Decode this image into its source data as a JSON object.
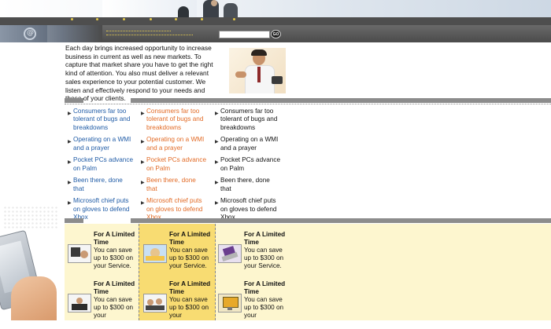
{
  "search": {
    "placeholder": "",
    "go_label": "GO"
  },
  "intro_text": "Each day brings increased opportunity to increase business in current as well as new markets. To capture that market share you have to get the right kind of attention. You also must deliver a relevant sales experience to your potential customer. We listen and effectively respond to your needs and those of your clients.",
  "news_columns": [
    {
      "color": "#1f5ba6",
      "items": [
        "Consumers far too tolerant of bugs and breakdowns",
        "Operating on a WMI and a prayer",
        "Pocket PCs advance on Palm",
        "Been there, done that",
        "Microsoft chief puts on gloves to defend Xbox"
      ]
    },
    {
      "color": "#e26a25",
      "items": [
        "Consumers far too tolerant of bugs and breakdowns",
        "Operating on a WMI and a prayer",
        "Pocket PCs advance on Palm",
        "Been there, done that",
        "Microsoft chief puts on gloves to defend Xbox"
      ]
    },
    {
      "color": "#111111",
      "items": [
        "Consumers far too tolerant of bugs and breakdowns",
        "Operating on a WMI and a prayer",
        "Pocket PCs advance on Palm",
        "Been there, done that",
        "Microsoft chief puts on gloves to defend Xbox"
      ]
    }
  ],
  "promos": [
    {
      "title": "For A Limited Time",
      "body": "You can save up to $300 on your Service.",
      "icon": "laptop-user-icon"
    },
    {
      "title": "For A Limited Time",
      "body": "You can save up to $300 on your Service.",
      "icon": "desk-worker-icon"
    },
    {
      "title": "For A Limited Time",
      "body": "You can save up to $300 on your Service.",
      "icon": "laptop-icon"
    },
    {
      "title": "For A Limited Time",
      "body": "You can save up to $300 on your",
      "icon": "monitor-user-icon"
    },
    {
      "title": "For A Limited Time",
      "body": "You can save up to $300 on your",
      "icon": "business-team-icon"
    },
    {
      "title": "For A Limited Time",
      "body": "You can save up to $300 on your",
      "icon": "monitor-icon"
    }
  ],
  "colors": {
    "link_blue": "#1f5ba6",
    "link_orange": "#e26a25",
    "promo_bg": "#fdf6cf",
    "promo_highlight": "#f8dc72",
    "nav_dark": "#4e4e4e"
  }
}
